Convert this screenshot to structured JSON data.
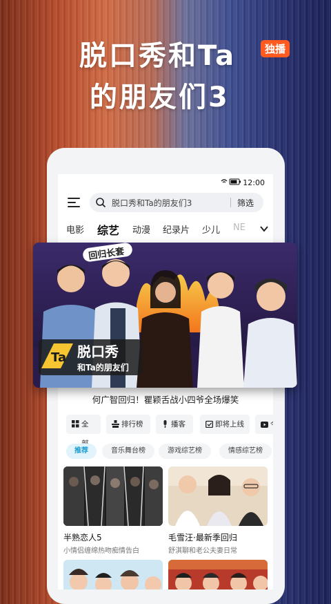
{
  "headline": {
    "line1": "脱口秀和Ta",
    "line2": "的朋友们3",
    "badge": "独播"
  },
  "status_bar": {
    "time": "12:00"
  },
  "search": {
    "placeholder": "脱口秀和Ta的朋友们3",
    "filter_label": "筛选"
  },
  "categories": [
    "电影",
    "综艺",
    "动漫",
    "纪录片",
    "少儿",
    "NE"
  ],
  "active_category": "综艺",
  "banner": {
    "corner_tag": "回归长套",
    "logo_line1": "脱口秀",
    "logo_line2": "和Ta的朋友们",
    "logo_mark": "Ta",
    "caption": "何广智回归！瞿颖舌战小四爷全场爆笑"
  },
  "quick_links": [
    {
      "label": "全部",
      "icon": "grid-icon"
    },
    {
      "label": "排行榜",
      "icon": "ranking-icon"
    },
    {
      "label": "播客",
      "icon": "microphone-icon"
    },
    {
      "label": "即将上线",
      "icon": "calendar-icon"
    },
    {
      "label": "今",
      "icon": "tv-icon"
    }
  ],
  "filter_pills": [
    "推荐",
    "音乐舞台榜",
    "游戏综艺榜",
    "情感综艺榜"
  ],
  "active_pill": "推荐",
  "cards": [
    {
      "title": "半熟恋人5",
      "subtitle": "小情侣缠绵热吻痴情告白"
    },
    {
      "title": "毛雪汪·最新季回归",
      "subtitle": "舒淇聊和老公夫妻日常"
    }
  ],
  "colors": {
    "accent_orange": "#ff5a1f",
    "pill_active_text": "#1b9bd1"
  }
}
